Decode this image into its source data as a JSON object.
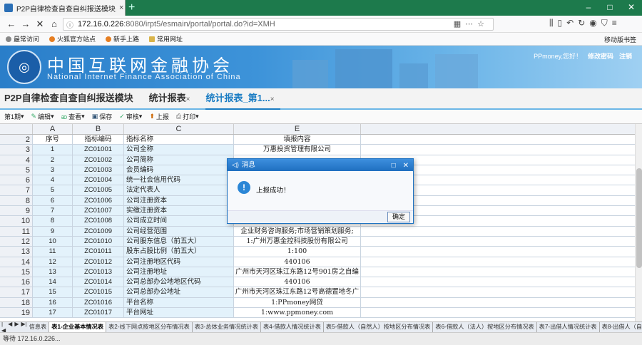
{
  "browser": {
    "tab_title": "P2P自律检查自查自纠报送模块.ex",
    "tab_close": "×",
    "new_tab": "+",
    "url_host": "172.16.0.226",
    "url_rest": ":8080/irpt5/esmain/portal/portal.do?id=XMH",
    "bookmarks": [
      "最常访问",
      "火狐官方站点",
      "新手上路",
      "常用网址"
    ],
    "mobile_bookmarks": "移动版书签"
  },
  "header": {
    "org_cn": "中国互联网金融协会",
    "org_en": "National Internet Finance Association of China",
    "user_greeting": "PPmoney,您好！",
    "change_password": "修改密码",
    "logout": "注销"
  },
  "app_tabs": [
    {
      "label": "P2P自律检查自查自纠报送模块",
      "close": ""
    },
    {
      "label": "统计报表",
      "close": "×"
    },
    {
      "label": "统计报表_第1...",
      "close": "×"
    }
  ],
  "toolbar": {
    "period": "第1期",
    "edit": "编辑",
    "view": "查看",
    "save": "保存",
    "review": "审核",
    "submit": "上报",
    "print": "打印"
  },
  "sheet": {
    "columns": [
      "A",
      "B",
      "C",
      "D",
      "E",
      "F"
    ],
    "header_row": {
      "num": "2",
      "a": "序号",
      "b": "指标编码",
      "c": "指标名称",
      "e": "填报内容"
    },
    "rows": [
      {
        "num": "3",
        "a": "1",
        "b": "ZC01001",
        "c": "公司全称",
        "e": "万惠投资管理有限公司"
      },
      {
        "num": "4",
        "a": "2",
        "b": "ZC01002",
        "c": "公司简称",
        "e": ""
      },
      {
        "num": "5",
        "a": "3",
        "b": "ZC01003",
        "c": "会员编码",
        "e": ""
      },
      {
        "num": "6",
        "a": "4",
        "b": "ZC01004",
        "c": "统一社会信用代码",
        "e": ""
      },
      {
        "num": "7",
        "a": "5",
        "b": "ZC01005",
        "c": "法定代表人",
        "e": ""
      },
      {
        "num": "8",
        "a": "6",
        "b": "ZC01006",
        "c": "公司注册资本",
        "e": ""
      },
      {
        "num": "9",
        "a": "7",
        "b": "ZC01007",
        "c": "实缴注册资本",
        "e": ""
      },
      {
        "num": "10",
        "a": "8",
        "b": "ZC01008",
        "c": "公司成立时间",
        "e": ""
      },
      {
        "num": "11",
        "a": "9",
        "b": "ZC01009",
        "c": "公司经营范围",
        "e": "企业财务咨询服务;市场营销策划服务;"
      },
      {
        "num": "12",
        "a": "10",
        "b": "ZC01010",
        "c": "公司股东信息（前五大）",
        "e": "1:广州万惠金控科技股份有限公司"
      },
      {
        "num": "13",
        "a": "11",
        "b": "ZC01011",
        "c": "股东占股比例（前五大）",
        "e": "1:100"
      },
      {
        "num": "14",
        "a": "12",
        "b": "ZC01012",
        "c": "公司注册地区代码",
        "e": "440106"
      },
      {
        "num": "15",
        "a": "13",
        "b": "ZC01013",
        "c": "公司注册地址",
        "e": "广州市天河区珠江东路12号901房之自编"
      },
      {
        "num": "16",
        "a": "14",
        "b": "ZC01014",
        "c": "公司总部办公地地区代码",
        "e": "440106"
      },
      {
        "num": "17",
        "a": "15",
        "b": "ZC01015",
        "c": "公司总部办公地址",
        "e": "广州市天河区珠江东路12号高德置地冬广"
      },
      {
        "num": "18",
        "a": "16",
        "b": "ZC01016",
        "c": "平台名称",
        "e": "1:PPmoney网贷"
      },
      {
        "num": "19",
        "a": "17",
        "b": "ZC01017",
        "c": "平台网址",
        "e": "1:www.ppmoney.com"
      }
    ]
  },
  "sheet_tabs": [
    "信息表",
    "表1-企业基本情况表",
    "表2-线下网点按地区分布情况表",
    "表3-总体业务情况统计表",
    "表4-借款人情况统计表",
    "表5-借款人（自然人）按地区分布情况表",
    "表6-借款人（法人）按地区分布情况表",
    "表7-出借人情况统计表",
    "表8-出借人（自然"
  ],
  "active_sheet_index": 1,
  "status": "等待 172.16.0.226...",
  "dialog": {
    "title": "消息",
    "message": "上报成功！",
    "ok": "确定"
  }
}
